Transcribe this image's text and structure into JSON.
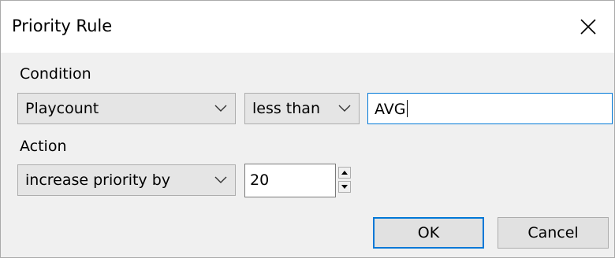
{
  "dialog": {
    "title": "Priority Rule",
    "close_icon": "close-icon"
  },
  "condition": {
    "label": "Condition",
    "field_select": {
      "value": "Playcount",
      "icon": "chevron-down-icon"
    },
    "operator_select": {
      "value": "less than",
      "icon": "chevron-down-icon"
    },
    "value_input": {
      "value": "AVG"
    }
  },
  "action": {
    "label": "Action",
    "action_select": {
      "value": "increase priority by",
      "icon": "chevron-down-icon"
    },
    "amount_spinner": {
      "value": "20",
      "up_icon": "spin-up-icon",
      "down_icon": "spin-down-icon"
    }
  },
  "buttons": {
    "ok": "OK",
    "cancel": "Cancel"
  },
  "colors": {
    "accent": "#0078d7",
    "dialog_bg": "#f0f0f0",
    "titlebar_bg": "#ffffff",
    "combo_bg": "#e5e5e5"
  }
}
